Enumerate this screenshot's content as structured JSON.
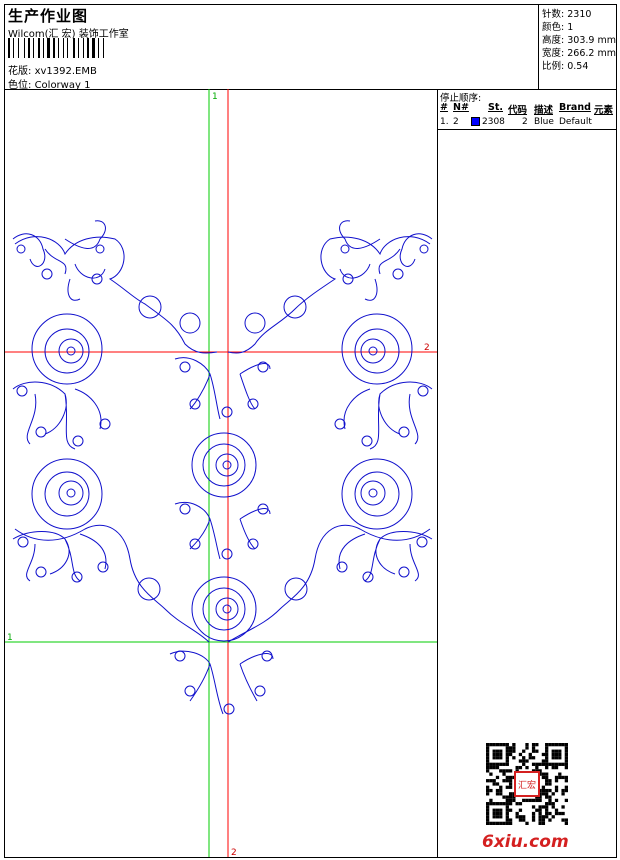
{
  "header": {
    "title": "生产作业图",
    "company": "Wilcom(汇 宏) 装饰工作室",
    "design_label": "花版:",
    "design_value": "xv1392.EMB",
    "colorway_label": "色位:",
    "colorway_value": "Colorway 1"
  },
  "stats": [
    {
      "label": "针数:",
      "value": "2310"
    },
    {
      "label": "颜色:",
      "value": "1"
    },
    {
      "label": "高度:",
      "value": "303.9 mm"
    },
    {
      "label": "宽度:",
      "value": "266.2 mm"
    },
    {
      "label": "比例:",
      "value": "0.54"
    }
  ],
  "canvas": {
    "guide_colors": {
      "vertical_green": "#00cc00",
      "red": "#ff0000",
      "stitch": "#0000cc"
    },
    "marker_v_top": "1",
    "marker_h_right": "2",
    "marker_h_left": "1",
    "marker_v_bottom": "2"
  },
  "stop_sequence": {
    "title": "停止顺序:",
    "columns": [
      "#",
      "N#",
      "St.",
      "代码",
      "描述",
      "Brand",
      "元素"
    ],
    "rows": [
      {
        "index": "1.",
        "needle": "2",
        "swatch_color": "#0000ff",
        "stitches": "2308",
        "code": "2",
        "description": "Blue",
        "brand": "Default",
        "element": ""
      }
    ]
  },
  "watermark": {
    "site": "6xiu.com",
    "seal_text": "汇宏"
  }
}
